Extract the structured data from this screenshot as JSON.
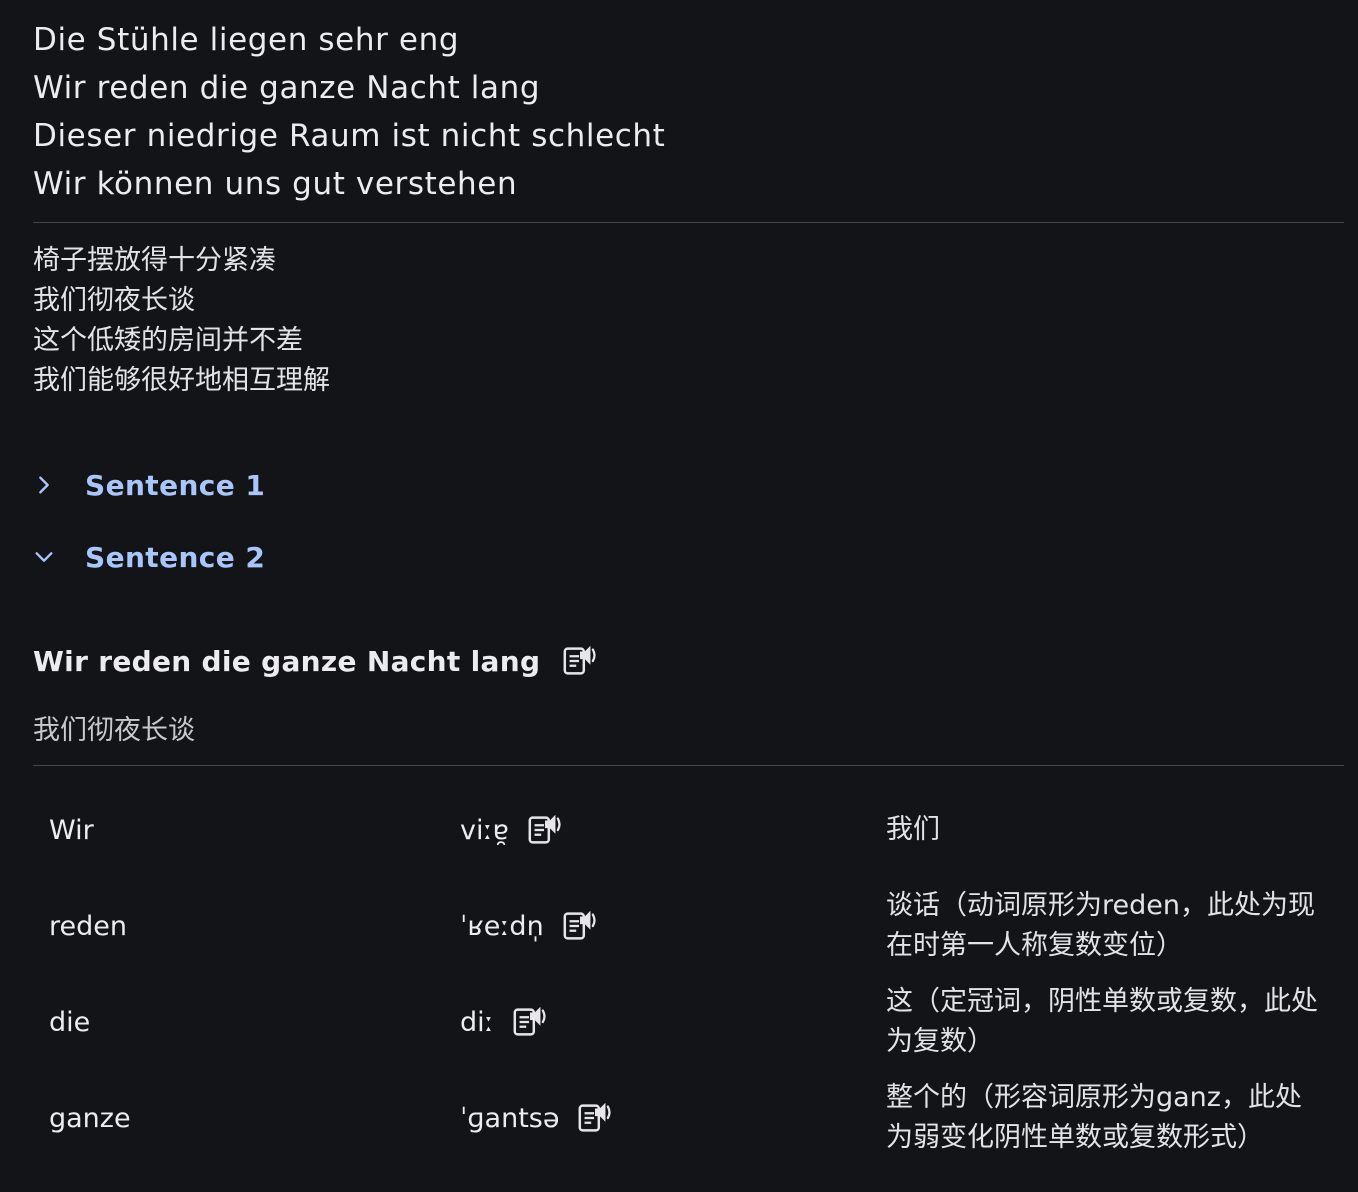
{
  "lyrics": {
    "german": [
      "Die Stühle liegen sehr eng",
      "Wir reden die ganze Nacht lang",
      "Dieser niedrige Raum ist nicht schlecht",
      "Wir können uns gut verstehen"
    ],
    "chinese": [
      "椅子摆放得十分紧凑",
      "我们彻夜长谈",
      "这个低矮的房间并不差",
      "我们能够很好地相互理解"
    ]
  },
  "sentences": [
    {
      "label": "Sentence 1",
      "expanded": false,
      "chevron": "chevron-right-icon"
    },
    {
      "label": "Sentence 2",
      "expanded": true,
      "chevron": "chevron-down-icon"
    }
  ],
  "detail": {
    "sentence": "Wir reden die ganze Nacht lang",
    "translation": "我们彻夜长谈",
    "speak_icon": "speaker-icon"
  },
  "words": [
    {
      "word": "Wir",
      "ipa": "viːɐ̯",
      "meaning": "我们"
    },
    {
      "word": "reden",
      "ipa": "ˈʁeːdn̩",
      "meaning": "谈话（动词原形为reden，此处为现在时第一人称复数变位）"
    },
    {
      "word": "die",
      "ipa": "diː",
      "meaning": "这（定冠词，阴性单数或复数，此处为复数）"
    },
    {
      "word": "ganze",
      "ipa": "ˈɡantsə",
      "meaning": "整个的（形容词原形为ganz，此处为弱变化阴性单数或复数形式）"
    }
  ],
  "colors": {
    "background": "#131417",
    "accent": "#a9c6fb",
    "divider": "#45464b"
  }
}
